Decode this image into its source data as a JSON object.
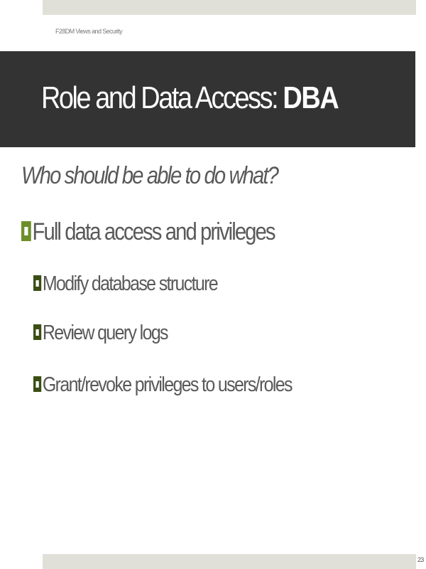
{
  "header": {
    "label": "F28DM Views and Security"
  },
  "slide": {
    "title_main": "Role and Data Access: ",
    "title_emphasis": "DBA",
    "question": "Who should be able to do what?",
    "bullets": [
      {
        "level": 1,
        "text": "Full data access and privileges"
      },
      {
        "level": 2,
        "text": "Modify database structure"
      },
      {
        "level": 2,
        "text": "Review query logs"
      },
      {
        "level": 2,
        "text": "Grant/revoke privileges to users/roles"
      }
    ]
  },
  "footer": {
    "page_number": "23"
  },
  "colors": {
    "title_bar": "#333333",
    "band": "#e0e0d8",
    "bullet_level1": "#6d8f2a",
    "bullet_level2": "#3b4e14",
    "body_text": "#595959"
  }
}
